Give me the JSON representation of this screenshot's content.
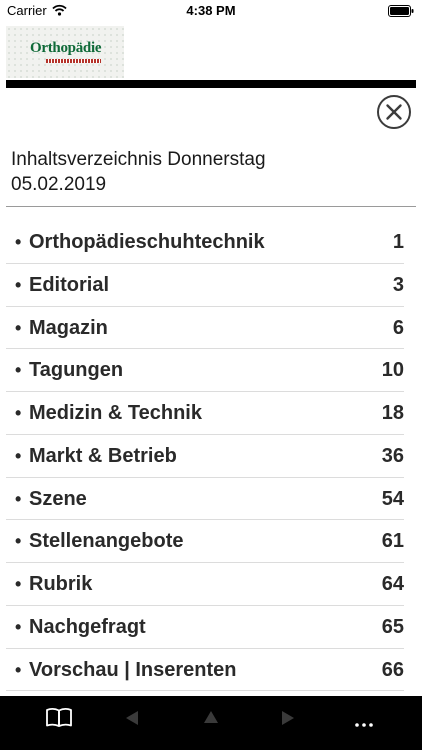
{
  "status_bar": {
    "carrier": "Carrier",
    "time": "4:38 PM",
    "icons": [
      "wifi-icon",
      "battery-icon"
    ]
  },
  "header": {
    "logo_text": "Orthopädie",
    "rule_color": "#000000"
  },
  "page_title": "Inhaltsverzeichnis Donnerstag 05.02.2019",
  "toc": {
    "bullet": "•",
    "items": [
      {
        "label": "Orthopädieschuhtechnik",
        "page": "1"
      },
      {
        "label": "Editorial",
        "page": "3"
      },
      {
        "label": "Magazin",
        "page": "6"
      },
      {
        "label": "Tagungen",
        "page": "10"
      },
      {
        "label": "Medizin & Technik",
        "page": "18"
      },
      {
        "label": "Markt & Betrieb",
        "page": "36"
      },
      {
        "label": "Szene",
        "page": "54"
      },
      {
        "label": "Stellenangebote",
        "page": "61"
      },
      {
        "label": "Rubrik",
        "page": "64"
      },
      {
        "label": "Nachgefragt",
        "page": "65"
      },
      {
        "label": "Vorschau | Inserenten",
        "page": "66"
      }
    ]
  },
  "toolbar": {
    "buttons": [
      "book-icon",
      "arrow-left-icon",
      "arrow-up-icon",
      "arrow-right-icon",
      "more-icon"
    ],
    "more_label": "...",
    "active_color": "#ffffff",
    "disabled_color": "#3a3a3a"
  },
  "colors": {
    "logo_green": "#0f6a38",
    "logo_red": "#b5332a"
  }
}
